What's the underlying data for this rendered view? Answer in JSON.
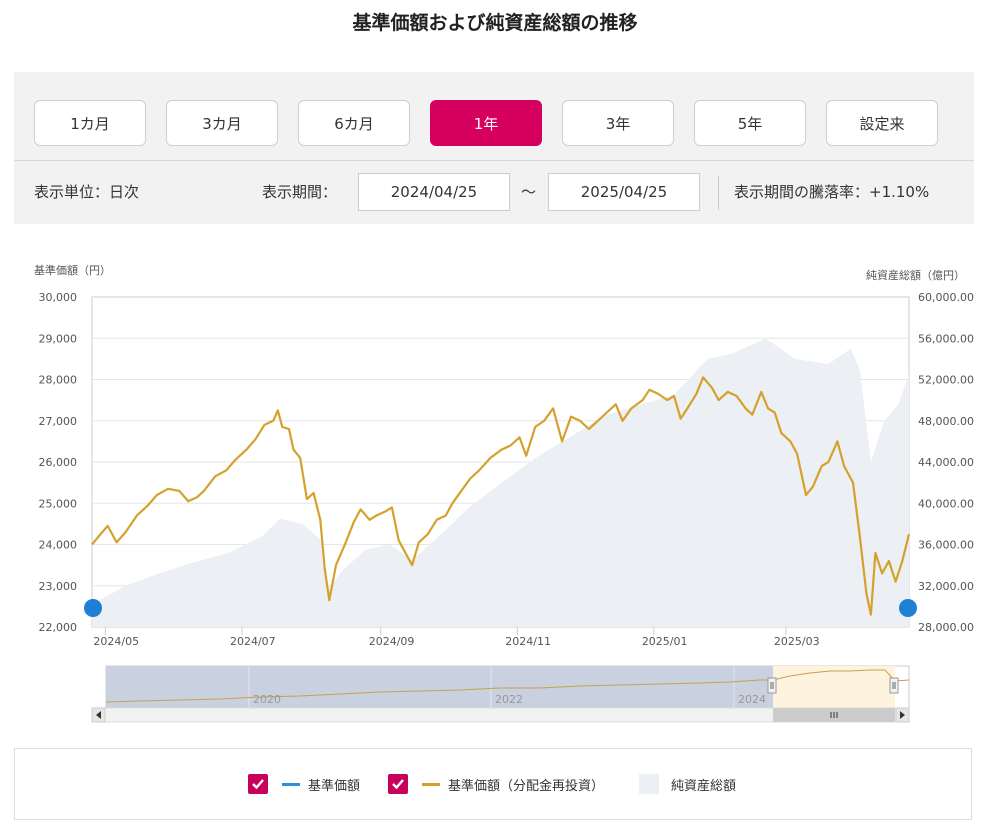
{
  "title": "基準価額および純資産総額の推移",
  "period_buttons": [
    "1カ月",
    "3カ月",
    "6カ月",
    "1年",
    "3年",
    "5年",
    "設定来"
  ],
  "active_period": "1年",
  "info": {
    "unit": "表示単位：日次",
    "period_label": "表示期間：",
    "start_date": "2024/04/25",
    "tilde": "～",
    "end_date": "2025/04/25",
    "change": "表示期間の騰落率：+1.10%"
  },
  "colors": {
    "accent": "#d6005f",
    "nav_reinvest": "#d4a22c",
    "nav": "#2e8fd8",
    "net_assets": "#eceff4"
  },
  "chart_data": {
    "type": "line",
    "left_axis_title": "基準価額（円）",
    "right_axis_title": "純資産総額（億円）",
    "y_left_ticks": [
      "30,000",
      "29,000",
      "28,000",
      "27,000",
      "26,000",
      "25,000",
      "24,000",
      "23,000",
      "22,000"
    ],
    "y_right_ticks": [
      "60,000.00",
      "56,000.00",
      "52,000.00",
      "48,000.00",
      "44,000.00",
      "40,000.00",
      "36,000.00",
      "32,000.00",
      "28,000.00"
    ],
    "x_ticks": [
      "2024/05",
      "2024/07",
      "2024/09",
      "2024/11",
      "2025/01",
      "2025/03"
    ],
    "ylim_left": [
      22000,
      30000
    ],
    "ylim_right": [
      28000,
      60000
    ],
    "x_range": [
      "2024-04-25",
      "2025-04-25"
    ],
    "series": [
      {
        "name": "基準価額（分配金再投資）",
        "axis": "left",
        "points": [
          [
            "2024-04-25",
            24000
          ],
          [
            "2024-04-28",
            24200
          ],
          [
            "2024-05-02",
            24450
          ],
          [
            "2024-05-06",
            24050
          ],
          [
            "2024-05-10",
            24300
          ],
          [
            "2024-05-15",
            24700
          ],
          [
            "2024-05-20",
            24950
          ],
          [
            "2024-05-24",
            25200
          ],
          [
            "2024-05-29",
            25350
          ],
          [
            "2024-06-03",
            25300
          ],
          [
            "2024-06-07",
            25050
          ],
          [
            "2024-06-11",
            25150
          ],
          [
            "2024-06-14",
            25300
          ],
          [
            "2024-06-19",
            25650
          ],
          [
            "2024-06-24",
            25800
          ],
          [
            "2024-06-28",
            26050
          ],
          [
            "2024-07-03",
            26300
          ],
          [
            "2024-07-07",
            26550
          ],
          [
            "2024-07-11",
            26900
          ],
          [
            "2024-07-15",
            27000
          ],
          [
            "2024-07-17",
            27250
          ],
          [
            "2024-07-19",
            26850
          ],
          [
            "2024-07-22",
            26800
          ],
          [
            "2024-07-24",
            26300
          ],
          [
            "2024-07-27",
            26100
          ],
          [
            "2024-07-30",
            25100
          ],
          [
            "2024-08-02",
            25250
          ],
          [
            "2024-08-05",
            24600
          ],
          [
            "2024-08-07",
            23400
          ],
          [
            "2024-08-09",
            22650
          ],
          [
            "2024-08-12",
            23500
          ],
          [
            "2024-08-16",
            24000
          ],
          [
            "2024-08-20",
            24550
          ],
          [
            "2024-08-23",
            24850
          ],
          [
            "2024-08-27",
            24600
          ],
          [
            "2024-08-30",
            24700
          ],
          [
            "2024-09-03",
            24800
          ],
          [
            "2024-09-06",
            24900
          ],
          [
            "2024-09-09",
            24100
          ],
          [
            "2024-09-12",
            23800
          ],
          [
            "2024-09-15",
            23500
          ],
          [
            "2024-09-18",
            24050
          ],
          [
            "2024-09-22",
            24250
          ],
          [
            "2024-09-26",
            24600
          ],
          [
            "2024-09-30",
            24700
          ],
          [
            "2024-10-03",
            25000
          ],
          [
            "2024-10-07",
            25300
          ],
          [
            "2024-10-11",
            25600
          ],
          [
            "2024-10-15",
            25800
          ],
          [
            "2024-10-20",
            26100
          ],
          [
            "2024-10-25",
            26300
          ],
          [
            "2024-10-29",
            26400
          ],
          [
            "2024-11-02",
            26600
          ],
          [
            "2024-11-05",
            26150
          ],
          [
            "2024-11-09",
            26850
          ],
          [
            "2024-11-13",
            27000
          ],
          [
            "2024-11-17",
            27300
          ],
          [
            "2024-11-21",
            26500
          ],
          [
            "2024-11-25",
            27100
          ],
          [
            "2024-11-29",
            27000
          ],
          [
            "2024-12-03",
            26800
          ],
          [
            "2024-12-07",
            27000
          ],
          [
            "2024-12-11",
            27200
          ],
          [
            "2024-12-15",
            27400
          ],
          [
            "2024-12-18",
            27000
          ],
          [
            "2024-12-22",
            27300
          ],
          [
            "2024-12-27",
            27500
          ],
          [
            "2024-12-30",
            27750
          ],
          [
            "2025-01-03",
            27650
          ],
          [
            "2025-01-07",
            27500
          ],
          [
            "2025-01-10",
            27600
          ],
          [
            "2025-01-13",
            27050
          ],
          [
            "2025-01-16",
            27300
          ],
          [
            "2025-01-20",
            27650
          ],
          [
            "2025-01-23",
            28050
          ],
          [
            "2025-01-27",
            27800
          ],
          [
            "2025-01-30",
            27500
          ],
          [
            "2025-02-03",
            27700
          ],
          [
            "2025-02-07",
            27600
          ],
          [
            "2025-02-11",
            27300
          ],
          [
            "2025-02-14",
            27150
          ],
          [
            "2025-02-18",
            27700
          ],
          [
            "2025-02-21",
            27300
          ],
          [
            "2025-02-24",
            27200
          ],
          [
            "2025-02-27",
            26700
          ],
          [
            "2025-03-03",
            26500
          ],
          [
            "2025-03-06",
            26200
          ],
          [
            "2025-03-10",
            25200
          ],
          [
            "2025-03-13",
            25400
          ],
          [
            "2025-03-17",
            25900
          ],
          [
            "2025-03-20",
            26000
          ],
          [
            "2025-03-24",
            26500
          ],
          [
            "2025-03-27",
            25900
          ],
          [
            "2025-03-31",
            25500
          ],
          [
            "2025-04-03",
            24200
          ],
          [
            "2025-04-06",
            22800
          ],
          [
            "2025-04-08",
            22300
          ],
          [
            "2025-04-10",
            23800
          ],
          [
            "2025-04-13",
            23300
          ],
          [
            "2025-04-16",
            23600
          ],
          [
            "2025-04-19",
            23100
          ],
          [
            "2025-04-22",
            23600
          ],
          [
            "2025-04-25",
            24250
          ]
        ]
      },
      {
        "name": "純資産総額",
        "axis": "right",
        "points": [
          [
            "2024-04-25",
            30200
          ],
          [
            "2024-05-10",
            32000
          ],
          [
            "2024-05-25",
            33200
          ],
          [
            "2024-06-10",
            34300
          ],
          [
            "2024-06-25",
            35200
          ],
          [
            "2024-07-10",
            36800
          ],
          [
            "2024-07-18",
            38500
          ],
          [
            "2024-07-28",
            38000
          ],
          [
            "2024-08-05",
            36500
          ],
          [
            "2024-08-08",
            31500
          ],
          [
            "2024-08-15",
            33500
          ],
          [
            "2024-08-25",
            35500
          ],
          [
            "2024-09-05",
            36000
          ],
          [
            "2024-09-15",
            34500
          ],
          [
            "2024-09-28",
            37000
          ],
          [
            "2024-10-10",
            39500
          ],
          [
            "2024-10-25",
            42000
          ],
          [
            "2024-11-10",
            44500
          ],
          [
            "2024-11-25",
            46500
          ],
          [
            "2024-12-10",
            48500
          ],
          [
            "2024-12-25",
            49500
          ],
          [
            "2025-01-10",
            50500
          ],
          [
            "2025-01-25",
            54000
          ],
          [
            "2025-02-05",
            54500
          ],
          [
            "2025-02-20",
            56000
          ],
          [
            "2025-03-05",
            54000
          ],
          [
            "2025-03-20",
            53500
          ],
          [
            "2025-03-30",
            55000
          ],
          [
            "2025-04-03",
            53000
          ],
          [
            "2025-04-08",
            44000
          ],
          [
            "2025-04-14",
            48000
          ],
          [
            "2025-04-20",
            49500
          ],
          [
            "2025-04-25",
            52500
          ]
        ]
      }
    ]
  },
  "navigator": {
    "years": [
      "2020",
      "2022",
      "2024"
    ]
  },
  "legend": {
    "items": [
      "基準価額",
      "基準価額（分配金再投資）",
      "純資産総額"
    ]
  }
}
